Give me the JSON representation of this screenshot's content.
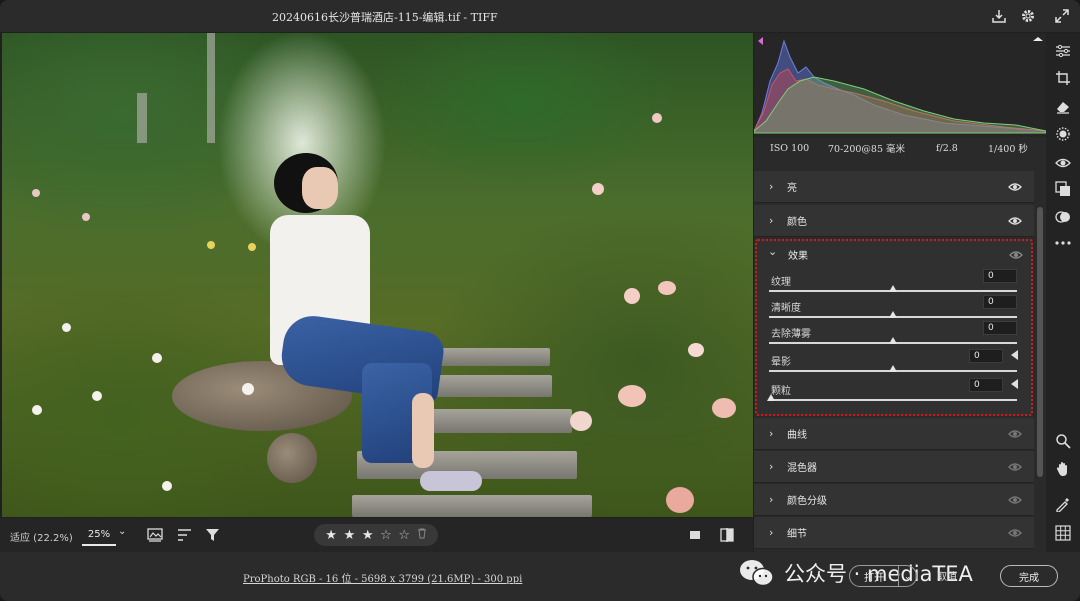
{
  "window": {
    "title": "20240616长沙普瑞酒店-115-编辑.tif -  TIFF"
  },
  "titlebar_icons": [
    "save-icon",
    "gear-icon",
    "expand-icon"
  ],
  "histogram": {
    "exif": {
      "iso": "ISO 100",
      "lens": "70-200@85 毫米",
      "aperture": "f/2.8",
      "shutter": "1/400 秒"
    }
  },
  "panels": {
    "light": {
      "label": "亮"
    },
    "color": {
      "label": "颜色"
    },
    "effects": {
      "label": "效果",
      "sliders": [
        {
          "label": "纹理",
          "value": "0",
          "position": 0.5
        },
        {
          "label": "清晰度",
          "value": "0",
          "position": 0.5
        },
        {
          "label": "去除薄雾",
          "value": "0",
          "position": 0.5
        },
        {
          "label": "晕影",
          "value": "0",
          "position": 0.5
        },
        {
          "label": "颗粒",
          "value": "0",
          "position": 0.0
        }
      ]
    },
    "curve": {
      "label": "曲线"
    },
    "mixer": {
      "label": "混色器"
    },
    "grading": {
      "label": "颜色分级"
    },
    "detail": {
      "label": "细节"
    }
  },
  "bottombar": {
    "zoom_fit": "适应 (22.2%)",
    "zoom_value": "25%",
    "rating": {
      "filled": 3,
      "total": 5
    }
  },
  "footer": {
    "fileinfo": "ProPhoto RGB - 16 位 - 5698 x 3799 (21.6MP) - 300 ppi",
    "watermark": "公众号 · mediaTEA",
    "open_label": "打开",
    "cancel_label": "取消",
    "done_label": "完成"
  },
  "toolstrip": [
    "edit-sliders-icon",
    "crop-icon",
    "eraser-icon",
    "masking-icon",
    "red-eye-icon",
    "presets-icon",
    "snapshots-icon",
    "more-icon",
    "zoom-icon",
    "hand-icon",
    "color-sampler-icon",
    "grid-icon"
  ]
}
